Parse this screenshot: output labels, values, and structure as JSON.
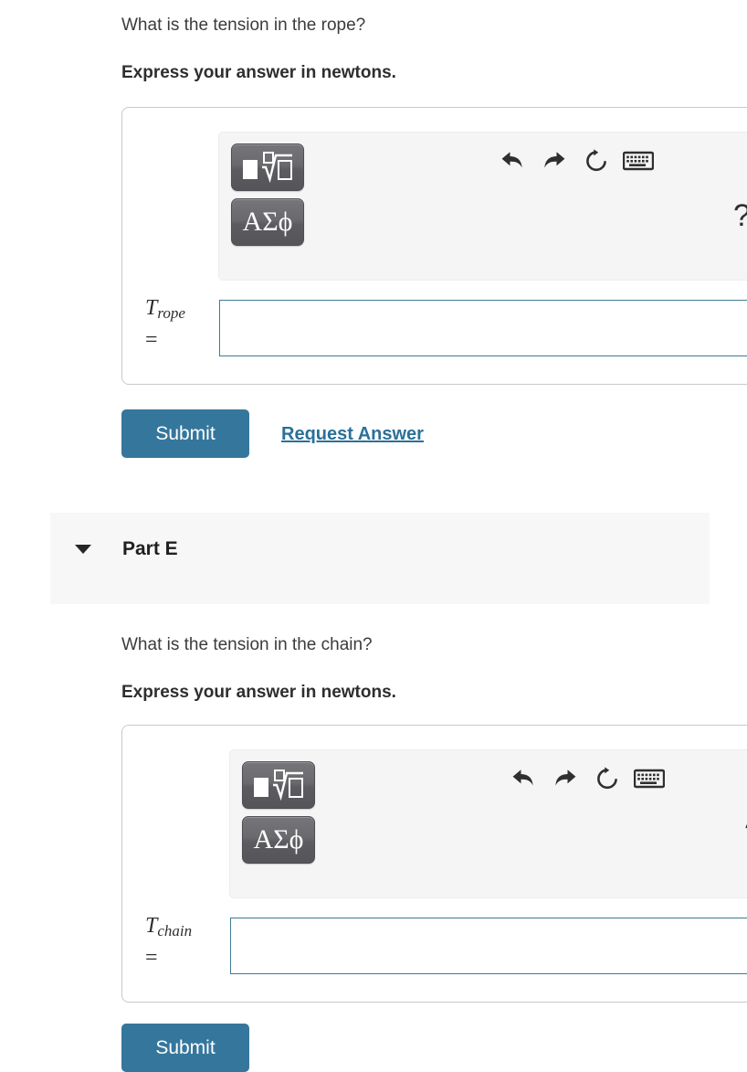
{
  "part_d": {
    "question": "What is the tension in the rope?",
    "instruction": "Express your answer in newtons.",
    "answer": {
      "variable": "T",
      "subscript": "rope",
      "equals": "=",
      "value": "",
      "placeholder": ""
    },
    "toolbar": {
      "template_button": "math-template",
      "greek_button": "ΑΣϕ",
      "undo": "undo",
      "redo": "redo",
      "reset": "reset",
      "keyboard": "keyboard",
      "help": "?"
    },
    "submit_label": "Submit",
    "request_answer_label": "Request Answer"
  },
  "part_e": {
    "header_title": "Part E",
    "caret": "collapse",
    "question": "What is the tension in the chain?",
    "instruction": "Express your answer in newtons.",
    "answer": {
      "variable": "T",
      "subscript": "chain",
      "equals": "=",
      "value": "",
      "placeholder": ""
    },
    "toolbar": {
      "template_button": "math-template",
      "greek_button": "ΑΣϕ",
      "undo": "undo",
      "redo": "redo",
      "reset": "reset",
      "keyboard": "keyboard",
      "help": "?"
    },
    "submit_label": "Submit"
  },
  "colors": {
    "accent": "#35779c",
    "link": "#2a7099",
    "input_border": "#3f7b95",
    "panel_border": "#c9c9c9",
    "band_bg": "#f7f7f7",
    "toolbar_bg": "#f5f5f5",
    "button_grey": "#6a6a6e",
    "text": "#333333"
  }
}
